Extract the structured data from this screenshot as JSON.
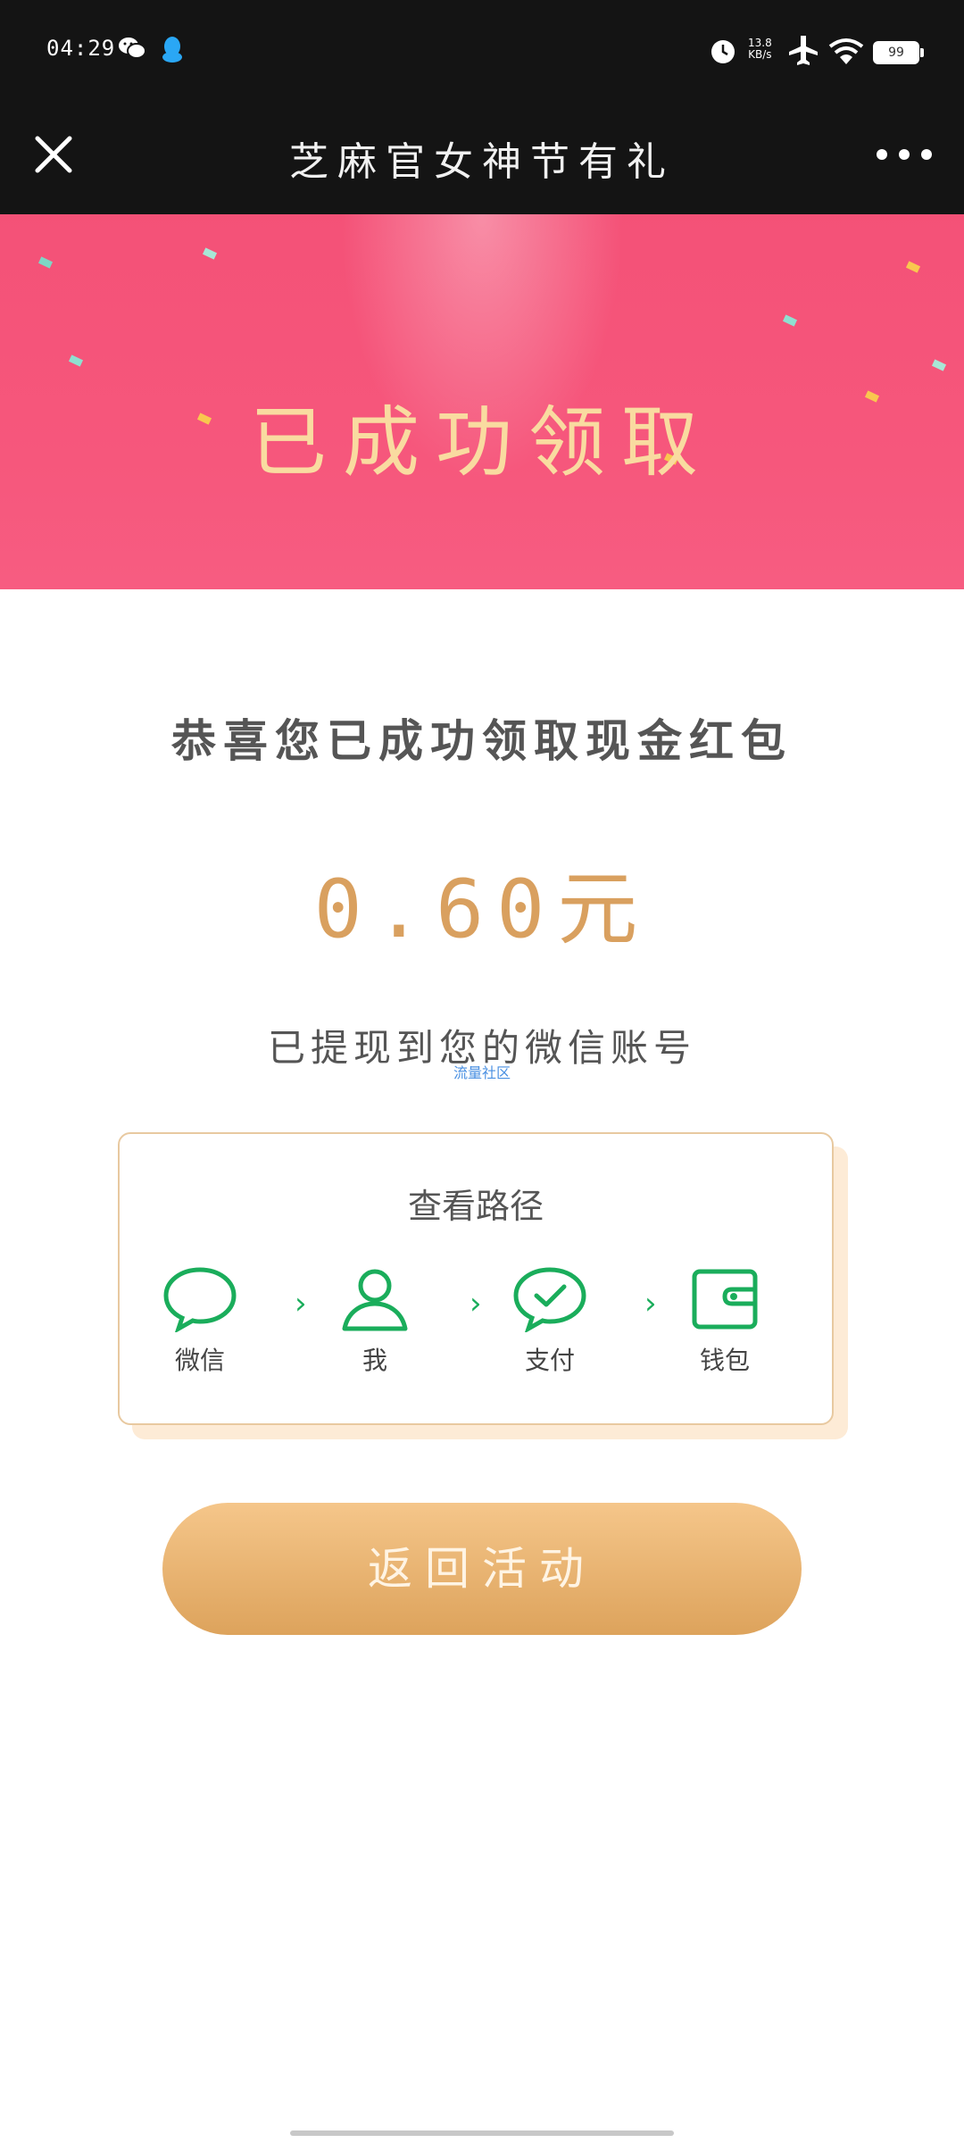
{
  "status_bar": {
    "time": "04:29",
    "net_speed_value": "13.8",
    "net_speed_unit": "KB/s",
    "battery": "99"
  },
  "header": {
    "title": "芝麻官女神节有礼"
  },
  "hero": {
    "title": "已成功领取",
    "bg_color": "#f24b72",
    "title_color": "#f9dba0"
  },
  "main": {
    "congrats": "恭喜您已成功领取现金红包",
    "amount": "0.60元",
    "withdraw_note": "已提现到您的微信账号",
    "watermark": "流量社区"
  },
  "path_card": {
    "title": "查看路径",
    "steps": [
      {
        "label": "微信",
        "icon": "chat-bubble-icon"
      },
      {
        "label": "我",
        "icon": "user-icon"
      },
      {
        "label": "支付",
        "icon": "pay-check-icon"
      },
      {
        "label": "钱包",
        "icon": "wallet-icon"
      }
    ],
    "accent_color": "#1aad5b"
  },
  "back_button": {
    "label": "返回活动"
  }
}
